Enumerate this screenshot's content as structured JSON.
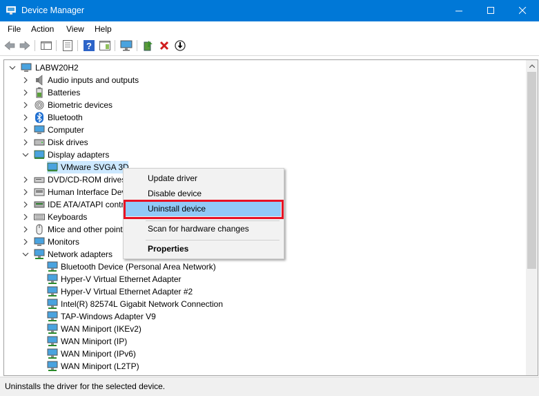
{
  "window": {
    "title": "Device Manager"
  },
  "menu": [
    "File",
    "Action",
    "View",
    "Help"
  ],
  "toolbar_icons": [
    "back-icon",
    "forward-icon",
    "show-hide-tree-icon",
    "properties-icon",
    "help-icon",
    "action-pane-icon",
    "monitor-icon",
    "update-driver-icon",
    "uninstall-icon",
    "download-icon"
  ],
  "tree": {
    "root": "LABW20H2",
    "categories": [
      {
        "label": "Audio inputs and outputs",
        "icon": "speaker-icon"
      },
      {
        "label": "Batteries",
        "icon": "battery-icon"
      },
      {
        "label": "Biometric devices",
        "icon": "fingerprint-icon"
      },
      {
        "label": "Bluetooth",
        "icon": "bluetooth-icon"
      },
      {
        "label": "Computer",
        "icon": "computer-icon"
      },
      {
        "label": "Disk drives",
        "icon": "disk-icon"
      },
      {
        "label": "Display adapters",
        "icon": "display-adapter-icon"
      },
      {
        "label": "VMware SVGA 3D",
        "icon": "display-adapter-icon"
      },
      {
        "label": "DVD/CD-ROM drives",
        "icon": "dvd-icon"
      },
      {
        "label": "Human Interface Dev",
        "icon": "hid-icon"
      },
      {
        "label": "IDE ATA/ATAPI contro",
        "icon": "ide-icon"
      },
      {
        "label": "Keyboards",
        "icon": "keyboard-icon"
      },
      {
        "label": "Mice and other point",
        "icon": "mouse-icon"
      },
      {
        "label": "Monitors",
        "icon": "monitor-icon"
      },
      {
        "label": "Network adapters",
        "icon": "network-icon"
      },
      {
        "label": "Bluetooth Device (Personal Area Network)",
        "icon": "network-icon"
      },
      {
        "label": "Hyper-V Virtual Ethernet Adapter",
        "icon": "network-icon"
      },
      {
        "label": "Hyper-V Virtual Ethernet Adapter #2",
        "icon": "network-icon"
      },
      {
        "label": "Intel(R) 82574L Gigabit Network Connection",
        "icon": "network-icon"
      },
      {
        "label": "TAP-Windows Adapter V9",
        "icon": "network-icon"
      },
      {
        "label": "WAN Miniport (IKEv2)",
        "icon": "network-icon"
      },
      {
        "label": "WAN Miniport (IP)",
        "icon": "network-icon"
      },
      {
        "label": "WAN Miniport (IPv6)",
        "icon": "network-icon"
      },
      {
        "label": "WAN Miniport (L2TP)",
        "icon": "network-icon"
      }
    ]
  },
  "context_menu": {
    "update": "Update driver",
    "disable": "Disable device",
    "uninstall": "Uninstall device",
    "scan": "Scan for hardware changes",
    "properties": "Properties"
  },
  "status": "Uninstalls the driver for the selected device.",
  "colors": {
    "titlebar": "#0078d7",
    "selection": "#cce8ff",
    "menu_highlight": "#91c9f7",
    "annotation": "#e81123"
  }
}
